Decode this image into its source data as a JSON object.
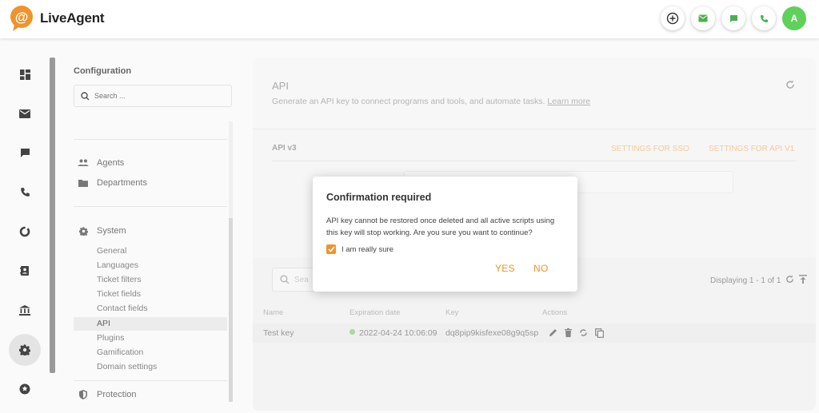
{
  "brand": {
    "name": "LiveAgent",
    "accent_color": "#f0932b"
  },
  "topbar": {
    "actions": [
      {
        "icon": "plus-circle-icon"
      },
      {
        "icon": "mail-icon",
        "color": "#4caf50"
      },
      {
        "icon": "chat-icon",
        "color": "#4caf50"
      },
      {
        "icon": "phone-icon",
        "color": "#4caf50"
      }
    ],
    "avatar_initial": "A",
    "avatar_color": "#5fd05a"
  },
  "rail": {
    "items": [
      "dashboard-icon",
      "mail-icon",
      "chat-icon",
      "phone-icon",
      "reports-icon",
      "contacts-icon",
      "bank-icon",
      "gear-icon",
      "star-icon"
    ],
    "active": "gear-icon"
  },
  "config": {
    "title": "Configuration",
    "search_placeholder": "Search ...",
    "groups": {
      "agents": "Agents",
      "departments": "Departments",
      "system": "System",
      "protection": "Protection"
    },
    "system_items": [
      "General",
      "Languages",
      "Ticket filters",
      "Ticket fields",
      "Contact fields",
      "API",
      "Plugins",
      "Gamification",
      "Domain settings"
    ],
    "active_item": "API"
  },
  "main": {
    "title": "API",
    "description": "Generate an API key to connect programs and tools, and automate tasks.",
    "learn_more": "Learn more",
    "section_label": "API v3",
    "tab_sso": "SETTINGS FOR SSO",
    "tab_api_v1": "SETTINGS FOR API V1",
    "list_search_placeholder": "Sea",
    "displaying": "Displaying 1 - 1 of 1",
    "columns": {
      "name": "Name",
      "expiration": "Expiration date",
      "key": "Key",
      "actions": "Actions"
    },
    "rows": [
      {
        "name": "Test key",
        "expiration": "2022-04-24 10:06:09",
        "key": "dq8pip9kisfexe08g9q5sp"
      }
    ]
  },
  "modal": {
    "title": "Confirmation required",
    "body": "API key cannot be restored once deleted and all active scripts using this key will stop working. Are you sure you want to continue?",
    "checkbox_label": "I am really sure",
    "checkbox_checked": true,
    "yes_label": "YES",
    "no_label": "NO"
  }
}
